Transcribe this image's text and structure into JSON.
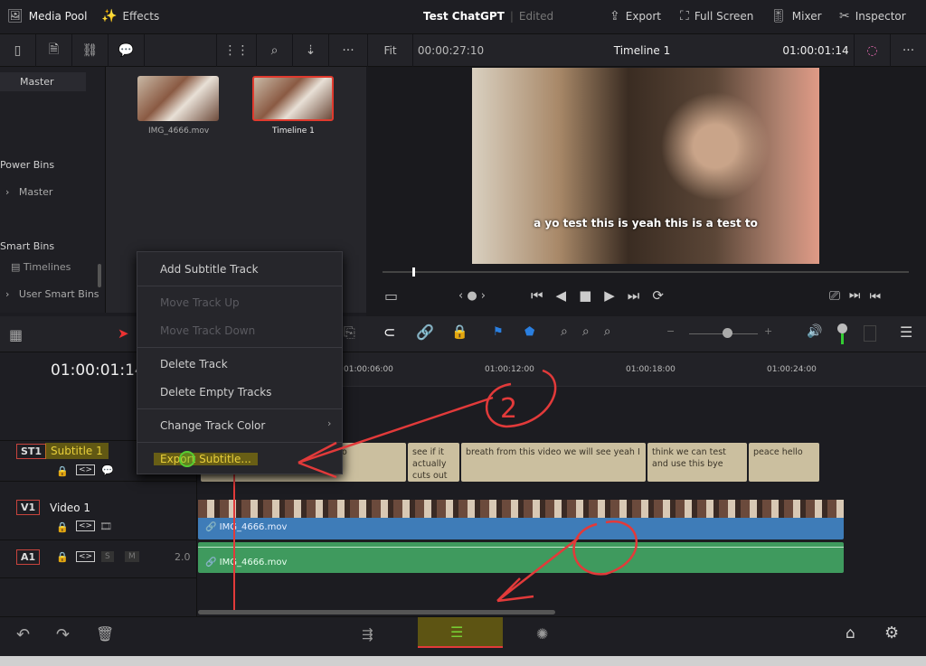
{
  "topbar": {
    "media_pool": "Media Pool",
    "effects": "Effects",
    "project": "Test ChatGPT",
    "status": "Edited",
    "export": "Export",
    "full_screen": "Full Screen",
    "mixer": "Mixer",
    "inspector": "Inspector"
  },
  "toolbar": {
    "fit": "Fit",
    "source_tc": "00:00:27:10",
    "timeline_name": "Timeline 1",
    "record_tc": "01:00:01:14"
  },
  "bins": {
    "master": "Master",
    "power_bins": "Power Bins",
    "power_master": "Master",
    "smart_bins": "Smart Bins",
    "timelines": "Timelines",
    "user_smart_bins": "User Smart Bins"
  },
  "media": [
    {
      "name": "IMG_4666.mov"
    },
    {
      "name": "Timeline 1"
    }
  ],
  "viewer": {
    "caption": "a yo test this is yeah this is a test to"
  },
  "timeline": {
    "timecode": "01:00:01:14",
    "ruler": [
      "01:00:06:00",
      "01:00:12:00",
      "01:00:18:00",
      "01:00:24:00"
    ],
    "tracks": {
      "st1": {
        "badge": "ST1",
        "name": "Subtitle 1"
      },
      "v1": {
        "badge": "V1",
        "name": "Video 1"
      },
      "a1": {
        "badge": "A1",
        "level": "2.0",
        "solo": "S",
        "mute": "M"
      }
    },
    "subtitle_clips": [
      "o",
      "see if it actually cuts out",
      "breath from this video we will see yeah I",
      "think we can test and use this bye",
      "peace hello"
    ],
    "video_clip": "IMG_4666.mov",
    "audio_clip": "IMG_4666.mov"
  },
  "context_menu": {
    "add": "Add Subtitle Track",
    "up": "Move Track Up",
    "down": "Move Track Down",
    "delete": "Delete Track",
    "delete_empty": "Delete Empty Tracks",
    "color": "Change Track Color",
    "export": "Export Subtitle..."
  },
  "annotations": {
    "circled_number": "2"
  },
  "colors": {
    "accent_red": "#e23a3a",
    "subtitle_clip": "#cbbf9f",
    "video_clip": "#3e7cb8",
    "audio_clip": "#3f9a5e",
    "highlight": "#c8b400"
  }
}
